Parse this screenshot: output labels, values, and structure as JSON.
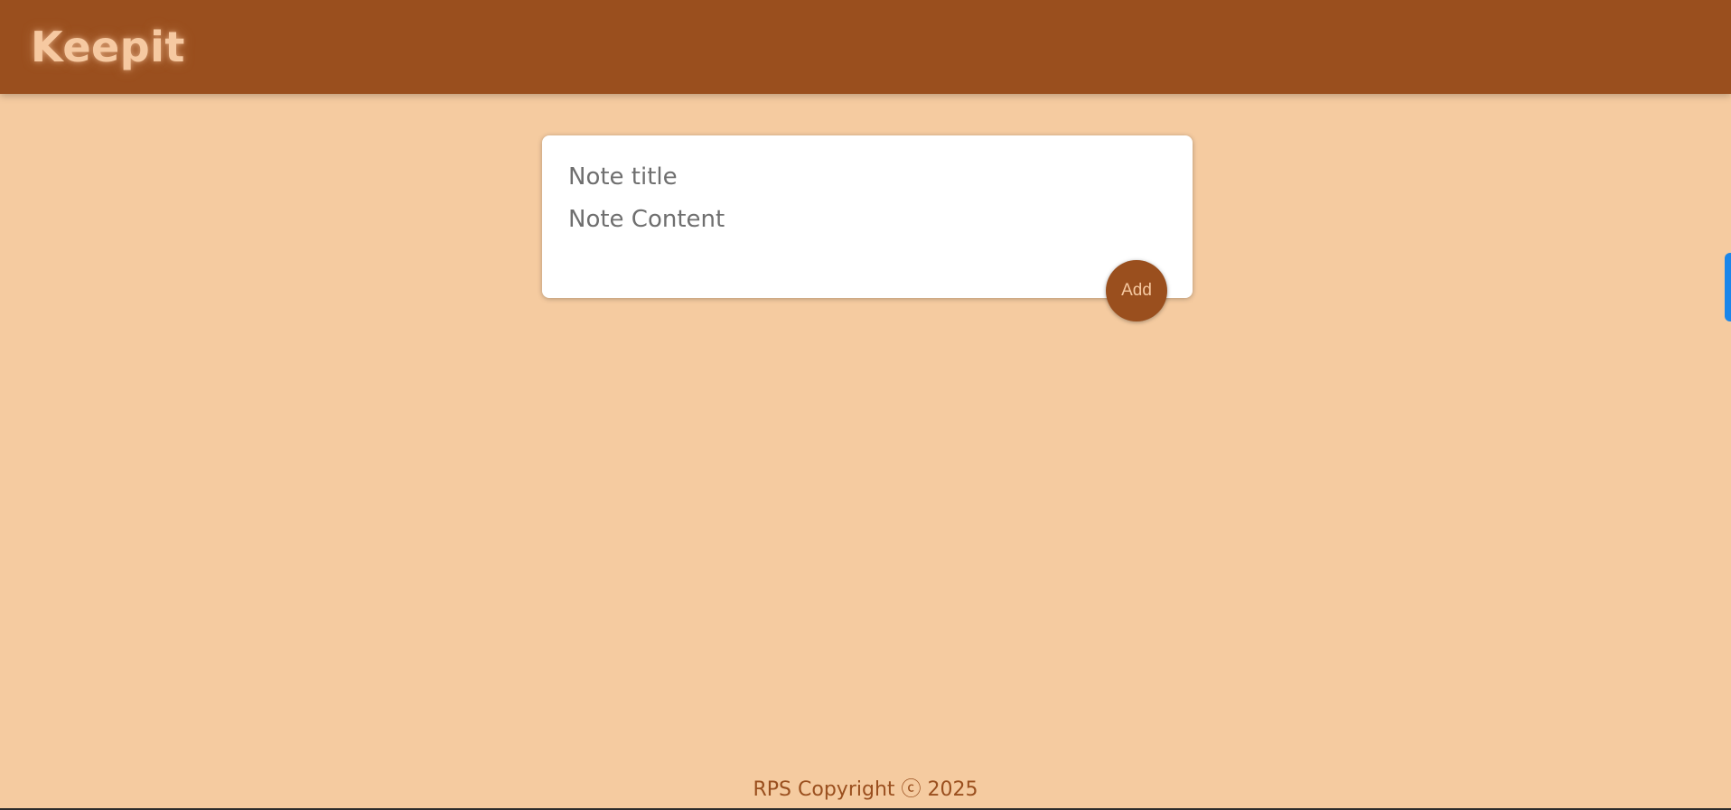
{
  "header": {
    "app_title": "Keepit"
  },
  "create_note": {
    "title_placeholder": "Note title",
    "title_value": "",
    "content_placeholder": "Note Content",
    "content_value": "",
    "add_label": "Add"
  },
  "footer": {
    "text": "RPS Copyright ⓒ 2025"
  },
  "colors": {
    "header_bg": "#9a4f1e",
    "page_bg": "#f5cba0",
    "title_text": "#f6c9a1",
    "side_tab": "#1a86ea"
  }
}
